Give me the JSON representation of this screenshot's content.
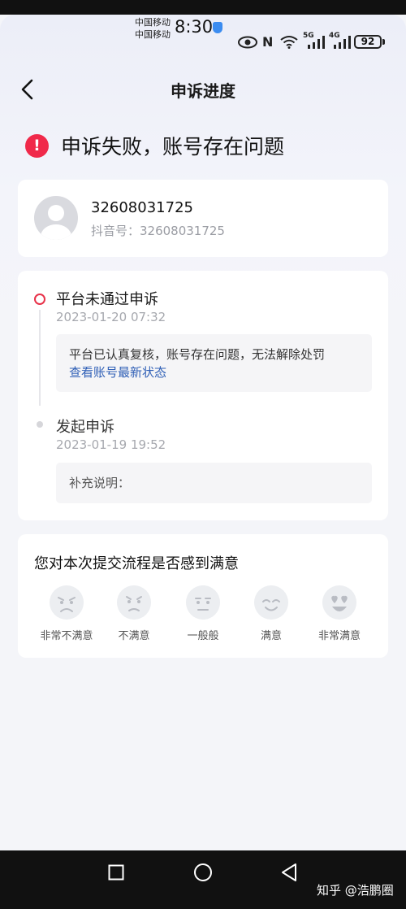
{
  "status_bar": {
    "carrier_line1": "中国移动",
    "carrier_line2": "中国移动",
    "time": "8:30",
    "battery": "92",
    "signal_5g": "5G",
    "signal_4g": "4G",
    "icons": [
      "eye-icon",
      "nfc-icon",
      "wifi-icon",
      "signal-5g-icon",
      "signal-4g-icon",
      "battery-icon"
    ]
  },
  "header": {
    "title": "申诉进度",
    "back_icon": "chevron-left-icon"
  },
  "result": {
    "icon": "alert-icon",
    "text": "申诉失败，账号存在问题",
    "color": "#f0294a"
  },
  "account": {
    "uid": "32608031725",
    "douyin_id": "抖音号：32608031725"
  },
  "progress": {
    "steps": [
      {
        "title": "平台未通过申诉",
        "time": "2023-01-20 07:32",
        "note": "平台已认真复核，账号存在问题，无法解除处罚",
        "link": "查看账号最新状态"
      },
      {
        "title": "发起申诉",
        "time": "2023-01-19 19:52",
        "note": "补充说明："
      }
    ]
  },
  "survey": {
    "title": "您对本次提交流程是否感到满意",
    "options": [
      {
        "label": "非常不满意",
        "icon": "very-unsatisfied-face-icon"
      },
      {
        "label": "不满意",
        "icon": "unsatisfied-face-icon"
      },
      {
        "label": "一般般",
        "icon": "neutral-face-icon"
      },
      {
        "label": "满意",
        "icon": "satisfied-face-icon"
      },
      {
        "label": "非常满意",
        "icon": "very-satisfied-face-icon"
      }
    ]
  },
  "nav_bar": {
    "icons": [
      "recents-square-icon",
      "home-circle-icon",
      "back-triangle-icon"
    ]
  },
  "watermark": "知乎 @浩鹏圈",
  "colors": {
    "accent_red": "#f0294a",
    "link_blue": "#2f5fb6"
  }
}
